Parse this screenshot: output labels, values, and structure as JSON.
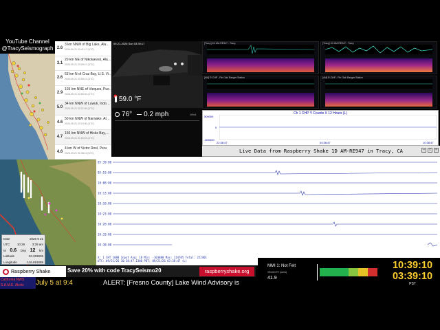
{
  "channel": {
    "line1": "YouTube Channel",
    "line2": "@TracySeismograph"
  },
  "quakes": [
    {
      "mag": "2.6",
      "place": "3 km NNW of Big Lake, Ala…",
      "time": "2026-09-21 03:41:17 (UTC)"
    },
    {
      "mag": "3.1",
      "place": "20 km NE of Nikolaevsk, Ala…",
      "time": "2026-09-21 03:08:47 (UTC)"
    },
    {
      "mag": "2.6",
      "place": "63 km N of Cruz Bay, U.S. Vi…",
      "time": "2026-09-21 02:58:12 (UTC)"
    },
    {
      "mag": "2.9",
      "place": "103 km NNE of Vieques, Pue…",
      "time": "2026-09-21 02:55:32 (UTC)"
    },
    {
      "mag": "5.0",
      "place": "34 km NNW of Luwuk, Indo…",
      "time": "2026-09-21 02:37:45 (UTC)"
    },
    {
      "mag": "4.6",
      "place": "50 km NNW of Narwake, At…",
      "time": "2026-09-21 02:19:06 (UTC)"
    },
    {
      "mag": "4.7",
      "place": "156 km NNW of Hicks Bay,…",
      "time": "2026-09-21 01:54:29 (UTC)"
    },
    {
      "mag": "4.6",
      "place": "4 km W of Victor Rosl, Peru",
      "time": "2026-09-21 01:38:11 (UTC)"
    },
    {
      "mag": "2.9",
      "place": "73 km N of Culebra, Puerto R…",
      "time": "2026-09-21 01:22:49 (UTC)"
    }
  ],
  "webcam": {
    "timestamp": "09-21-2026 Sun 03:39:17"
  },
  "weather": {
    "temperature": "59.0 °F",
    "outdoor_temp": "76°",
    "wind": "0.2 mph",
    "wind_label": "Wind"
  },
  "spectrograms": [
    {
      "title": "[Tracy] 1D AM-RE947 - Tracy"
    },
    {
      "title": "[Tracy] 1D AM-RE947 - Tracy"
    },
    {
      "title": "[AM] R-CHP - Pin Oak Ranger Station"
    },
    {
      "title": "[AM] R-CHP - Pin Oak Ranger Station"
    }
  ],
  "strip": {
    "title": "Ch 1 CHP Y Counts X 12 Hours (L)",
    "y_ticks": [
      "500000",
      "0",
      "-500000"
    ],
    "x_ticks": [
      "22:38:47",
      "04:38:47",
      "10:38:47"
    ]
  },
  "live": {
    "title": "Live Data from Raspberry Shake 1D AM-RE947 in Tracy, CA",
    "y_labels": [
      "05:39:00",
      "05:53:00",
      "10:08:00",
      "10:13:00",
      "10:18:00",
      "10:23:00",
      "10:28:00",
      "10:33:00",
      "10:38:00"
    ],
    "footer1": "X: 1 CHT 1080  Input Avg: 18    Min: -103088    Max: 114785    Total: 222401",
    "footer2": "UTC: 09/21/26 10:38:47.1380  PDT: 09/21/26 03:38:47 (L)"
  },
  "map_info": {
    "date_label": "Date",
    "date_value": "2026  9  21",
    "utc_label": "UTC",
    "utc_value": "10:29",
    "time_value": "3:29 am",
    "mag_label": "M",
    "mag_value": "0.6",
    "depth_label": "Dep",
    "depth_value": "12",
    "depth_unit": "km",
    "lat_label": "Latitude",
    "lat_value": "33.393605",
    "lon_label": "Longitude",
    "lon_value": "-116.691689"
  },
  "promo": {
    "logo": "Raspberry Shake",
    "text": "Save 20% with code TracySeismo20",
    "url": "raspberryshake.org"
  },
  "ticker": {
    "logo_line1": "California NWS",
    "logo_line2": "S.A.M.E. Alerts",
    "date_text": "July 5 at 9:4",
    "alert": "ALERT: [Fresno County] Lake Wind Advisory is"
  },
  "mmi": {
    "label": "MMI 1: Not Felt",
    "velocity_label": "VELOCITY (um/s)",
    "velocity_value": "41.9",
    "scale_colors": [
      "#22b14c",
      "#88c540",
      "#e6c227",
      "#d32f2f"
    ]
  },
  "clocks": {
    "utc": "10:39:10",
    "local": "03:39:10",
    "tz": "PST"
  }
}
